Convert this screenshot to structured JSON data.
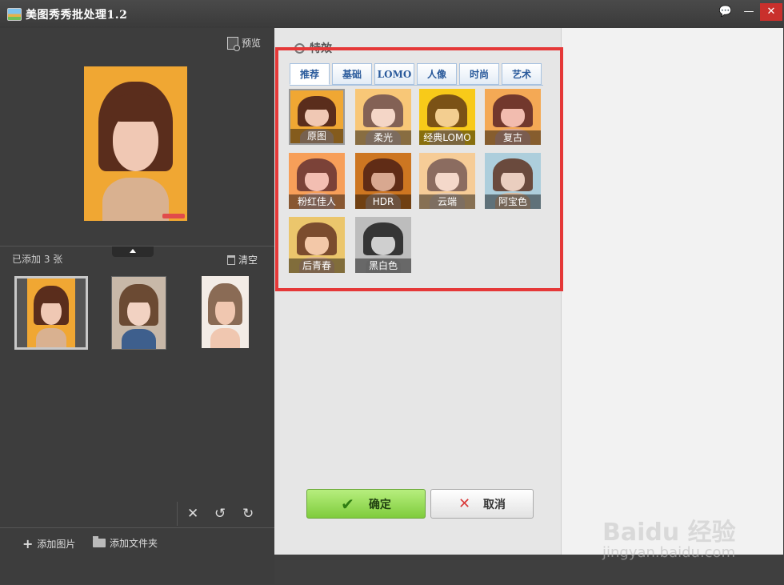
{
  "window": {
    "title": "美图秀秀批处理1.2",
    "buttons": [
      "💬",
      "—",
      "✕"
    ]
  },
  "left": {
    "preview_label": "预览",
    "added_label": "已添加 3 张",
    "clear_label": "清空",
    "thumbnails": [
      {
        "palette": {
          "bg": "#f0a733",
          "hair": "#5a2d1c",
          "face": "#f0c8b4",
          "body": "#d9b190"
        }
      },
      {
        "palette": {
          "bg": "#c8b8a8",
          "hair": "#6b4a33",
          "face": "#f2d2c2",
          "body": "#3e5f8d"
        }
      },
      {
        "palette": {
          "bg": "#f3ece6",
          "hair": "#8a6b55",
          "face": "#f0c7b0",
          "body": "#f0c7b0"
        }
      }
    ],
    "bottom": {
      "add_image": "添加图片",
      "add_folder": "添加文件夹"
    }
  },
  "effects": {
    "title": "特效",
    "tabs": [
      "推荐",
      "基础",
      "LOMO",
      "人像",
      "时尚",
      "艺术"
    ],
    "items": [
      {
        "label": "原图",
        "bg": "#f0a733",
        "tint": "transparent"
      },
      {
        "label": "柔光",
        "bg": "#f6b54a",
        "tint": "rgba(255,255,255,0.25)"
      },
      {
        "label": "经典LOMO",
        "bg": "#f7c420",
        "tint": "rgba(255,230,0,0.2)"
      },
      {
        "label": "复古",
        "bg": "#f2b24a",
        "tint": "rgba(255,120,150,0.15)"
      },
      {
        "label": "粉红佳人",
        "bg": "#f5a245",
        "tint": "rgba(255,150,170,0.2)"
      },
      {
        "label": "HDR",
        "bg": "#e38a2a",
        "tint": "rgba(120,40,0,0.2)"
      },
      {
        "label": "云端",
        "bg": "#f3b76a",
        "tint": "rgba(255,255,255,0.3)"
      },
      {
        "label": "阿宝色",
        "bg": "#a9c8d6",
        "tint": "rgba(200,240,255,0.15)"
      },
      {
        "label": "后青春",
        "bg": "#e6c66a",
        "tint": "rgba(255,200,120,0.2)"
      },
      {
        "label": "黑白色",
        "bg": "#bdbdbd",
        "tint": "grayscale"
      }
    ]
  },
  "actions": {
    "ok": "确定",
    "cancel": "取消"
  },
  "watermark": {
    "logo": "Baidu 经验",
    "url": "jingyan.baidu.com"
  }
}
